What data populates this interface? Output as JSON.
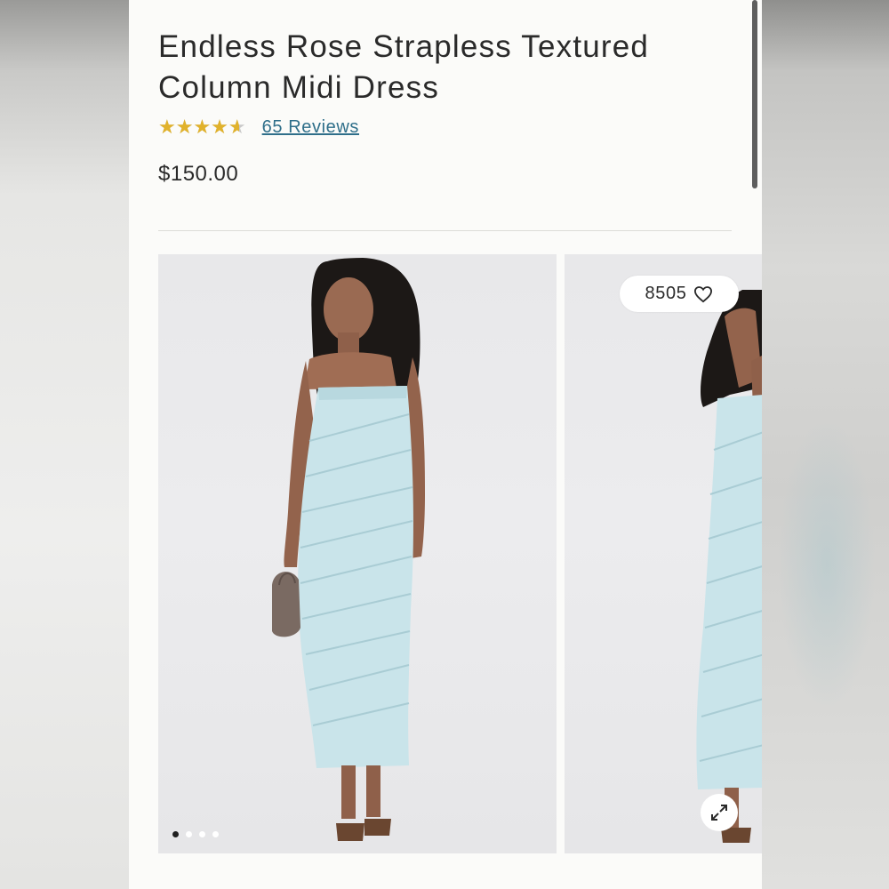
{
  "product": {
    "title": "Endless Rose Strapless Textured Column Midi Dress",
    "rating": 4.6,
    "rating_max": 5,
    "reviews_label": "65 Reviews",
    "price": "$150.00"
  },
  "gallery": {
    "image_count": 4,
    "active_index": 0,
    "wishlist_count": "8505",
    "icons": {
      "wishlist": "heart-icon",
      "expand": "expand-icon"
    }
  },
  "colors": {
    "star": "#e1b22b",
    "link": "#2f6f8a",
    "dress": "#c9e4ea"
  }
}
